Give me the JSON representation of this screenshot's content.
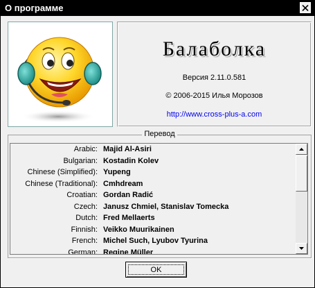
{
  "window": {
    "title": "О программе"
  },
  "about": {
    "app_name": "Балаболка",
    "version": "Версия 2.11.0.581",
    "copyright": "© 2006-2015 Илья Морозов",
    "website": "http://www.cross-plus-a.com"
  },
  "translations": {
    "group_title": "Перевод",
    "rows": [
      {
        "language": "Arabic:",
        "translator": "Majid Al-Asiri"
      },
      {
        "language": "Bulgarian:",
        "translator": "Kostadin Kolev"
      },
      {
        "language": "Chinese (Simplified):",
        "translator": "Yupeng"
      },
      {
        "language": "Chinese (Traditional):",
        "translator": "Cmhdream"
      },
      {
        "language": "Croatian:",
        "translator": "Gordan Radić"
      },
      {
        "language": "Czech:",
        "translator": "Janusz Chmiel, Stanislav Tomecka"
      },
      {
        "language": "Dutch:",
        "translator": "Fred Mellaerts"
      },
      {
        "language": "Finnish:",
        "translator": "Veikko Muurikainen"
      },
      {
        "language": "French:",
        "translator": "Michel Such, Lyubov Tyurina"
      },
      {
        "language": "German:",
        "translator": "Regine Müller"
      }
    ]
  },
  "buttons": {
    "ok_label": "OK"
  },
  "icons": {
    "close": "close-icon",
    "logo": "headset-smiley-logo",
    "scroll_up": "arrow-up-icon",
    "scroll_down": "arrow-down-icon"
  },
  "colors": {
    "title_bar": "#000000",
    "link": "#0000ee",
    "face": "#f0f0f0"
  }
}
